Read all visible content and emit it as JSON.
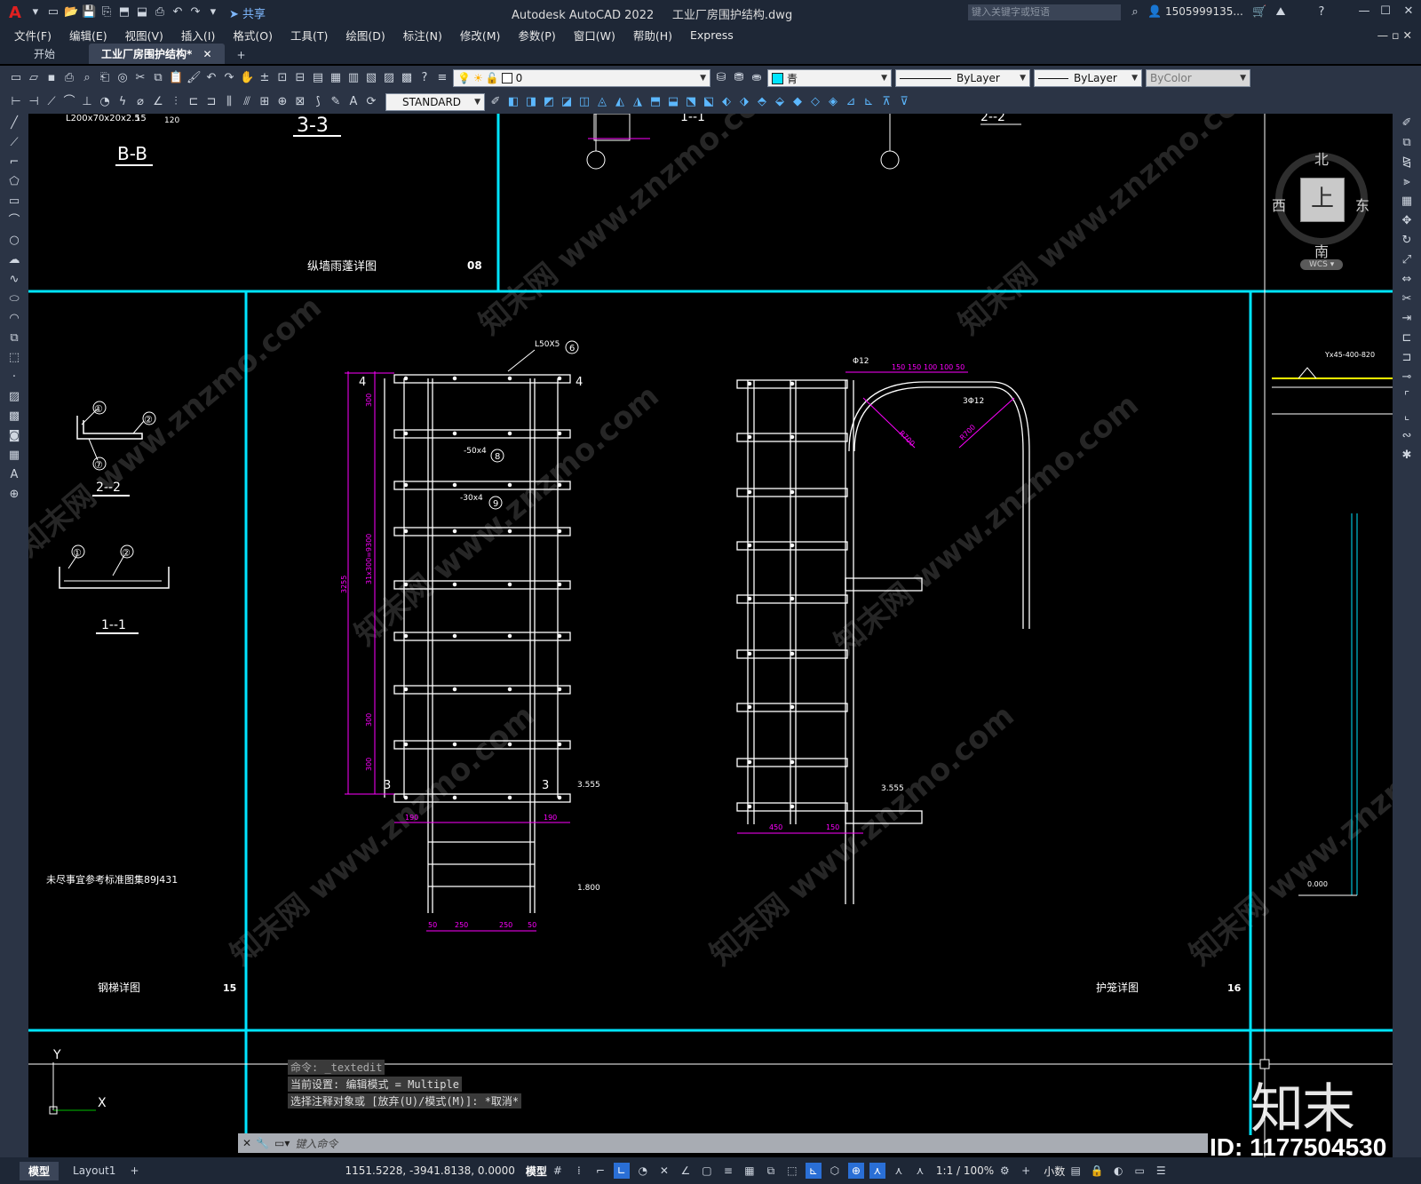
{
  "title_bar": {
    "app_letter": "A",
    "share_label": "共享",
    "app_title": "Autodesk AutoCAD 2022",
    "file_title": "工业厂房围护结构.dwg",
    "search_placeholder": "键入关键字或短语",
    "user": "1505999135...",
    "window_buttons": [
      "—",
      "☐",
      "✕"
    ]
  },
  "menu_bar": {
    "items": [
      "文件(F)",
      "编辑(E)",
      "视图(V)",
      "插入(I)",
      "格式(O)",
      "工具(T)",
      "绘图(D)",
      "标注(N)",
      "修改(M)",
      "参数(P)",
      "窗口(W)",
      "帮助(H)",
      "Express"
    ]
  },
  "tab_bar": {
    "tabs": [
      {
        "label": "开始",
        "active": false
      },
      {
        "label": "工业厂房围护结构*",
        "active": true
      }
    ],
    "new_tab": "+"
  },
  "toolbar": {
    "layer_value": "0",
    "color_value": "青",
    "linetype_value": "ByLayer",
    "lineweight_value": "ByLayer",
    "plotstyle_value": "ByColor",
    "textstyle_value": "STANDARD",
    "cyan": "#00e5ff"
  },
  "viewcube": {
    "north": "北",
    "south": "南",
    "east": "东",
    "west": "西",
    "top": "上",
    "wcs": "WCS"
  },
  "drawing": {
    "section_33": "3-3",
    "section_bb": "B-B",
    "top_label_partial": "L200x70x20x2.5",
    "top_num_15": "15",
    "top_num_120": "120",
    "top_1_1": "1--1",
    "top_2_2": "2--2",
    "panel_08_title": "纵墙雨蓬详图",
    "panel_08_num": "08",
    "panel_15_title": "钢梯详图",
    "panel_15_num": "15",
    "panel_16_title": "护笼详图",
    "panel_16_num": "16",
    "section_2_2": "2--2",
    "section_1_1": "1--1",
    "note_89j431": "未尽事宜参考标准图集89J431",
    "callouts": [
      "①",
      "②",
      "⑦",
      "①",
      "②"
    ],
    "ladder": {
      "label_top": "L50X5",
      "circle_6": "6",
      "flat_8": "-50x4",
      "circle_8": "8",
      "flat_9": "-30x4",
      "circle_9": "9",
      "mark_4": "4",
      "mark_3": "3",
      "elev_top": "3.555",
      "elev_bottom": "1.800",
      "dim_190": "190",
      "dim_250": "250",
      "dim_50": "50",
      "dim_300": "300",
      "dim_total": "3255",
      "dim_mid": "31x300=9300"
    },
    "cage": {
      "rod": "Φ12",
      "rod_count": "3Φ12",
      "dim_r": "R700",
      "dims_top": [
        "150",
        "150",
        "100",
        "100",
        "50"
      ],
      "dim_450": "450",
      "dim_150": "150",
      "elev": "3.555"
    },
    "right_edge": {
      "label": "Yx45-400-820",
      "elev": "0.000"
    },
    "watermark": "知末网 www.znzmo.com"
  },
  "command_area": {
    "history": [
      "命令: _textedit",
      "当前设置: 编辑模式 = Multiple",
      "选择注释对象或 [放弃(U)/模式(M)]: *取消*"
    ],
    "input_placeholder": "键入命令"
  },
  "ucs": {
    "y": "Y",
    "x": "X"
  },
  "layout_tabs": [
    "模型",
    "Layout1"
  ],
  "status_bar": {
    "coords": "1151.5228, -3941.8138, 0.0000",
    "model": "模型",
    "scale": "1:1 / 100%",
    "units": "小数"
  },
  "branding": {
    "logo": "知末",
    "id": "ID: 1177504530"
  },
  "colors": {
    "frame": "#00e5ff",
    "dim": "#ff00ff",
    "geometry": "#ffffff",
    "panel_bg": "#2b3445",
    "title_bg": "#1e2736",
    "yellow": "#ffff00"
  }
}
